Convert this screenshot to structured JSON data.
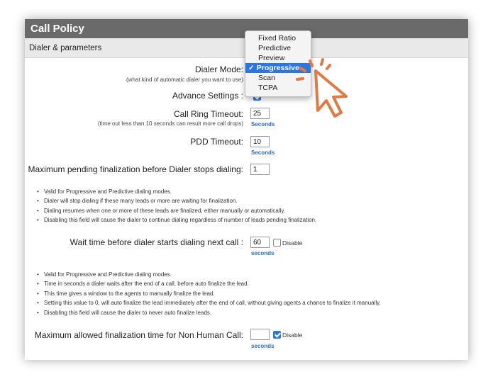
{
  "title": "Call Policy",
  "section": "Dialer & parameters",
  "dialer_mode": {
    "label": "Dialer Mode:",
    "hint": "(what kind of automatic dialer you want to use)",
    "options": [
      "Fixed Ratio",
      "Predictive",
      "Preview",
      "Progressive",
      "Scan",
      "TCPA"
    ],
    "selected_mark": "✓",
    "selected": "Progressive"
  },
  "advance_settings": {
    "label": "Advance Settings :",
    "checked": true
  },
  "ring_timeout": {
    "label": "Call Ring Timeout:",
    "hint": "(time out less than 10 seconds can result more call drops)",
    "value": "25",
    "unit": "Seconds"
  },
  "pdd_timeout": {
    "label": "PDD Timeout:",
    "value": "10",
    "unit": "Seconds"
  },
  "max_pending": {
    "label": "Maximum pending finalization before Dialer stops dialing:",
    "value": "1"
  },
  "notes_pending": [
    "Valid for Progressive and Predictive dialing modes.",
    "Dialer will stop dialing if these many leads or more are waiting for finalization.",
    "Dialing resumes when one or more of these leads are finalized, either manually or automatically.",
    "Disabling this field will cause the dialer to continue dialing regardless of number of leads pending finalization."
  ],
  "wait_time": {
    "label": "Wait time before dialer starts dialing next call :",
    "value": "60",
    "unit": "seconds",
    "disable_label": "Disable",
    "disabled": false
  },
  "notes_wait": [
    "Valid for Progressive and Predictive dialing modes.",
    "Time in seconds a dialer waits after the end of a call, before auto finalize the lead.",
    "This time gives a window to the agents to manually finalize the lead.",
    "Setting this value to 0, will auto finalize the lead immediately after the end of call, without giving agents a chance to finalize it manually.",
    "Disabling this field will cause the dialer to never auto finalize leads."
  ],
  "non_human": {
    "label": "Maximum allowed finalization time for Non Human Call:",
    "value": "",
    "unit": "seconds",
    "disable_label": "Disable",
    "disabled": true
  },
  "colors": {
    "titlebar": "#6a6a6a",
    "accent": "#2b76e5",
    "cursor": "#e07a45"
  },
  "icons": [
    "checkmark-icon",
    "pointer-cursor-icon"
  ]
}
